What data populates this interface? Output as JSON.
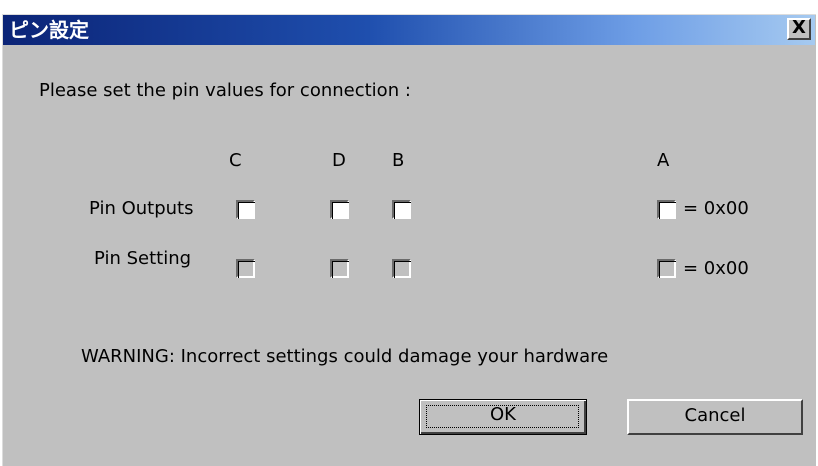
{
  "window": {
    "title": "ピン設定",
    "close_label": "X"
  },
  "dialog": {
    "instruction": "Please set the pin values for connection :",
    "columns": {
      "c": "C",
      "d": "D",
      "b": "B",
      "a": "A"
    },
    "rows": {
      "outputs_label": "Pin Outputs",
      "setting_label": "Pin Setting"
    },
    "outputs_value": "= 0x00",
    "setting_value": "= 0x00",
    "warning": "WARNING: Incorrect settings could damage your hardware",
    "ok_label": "OK",
    "cancel_label": "Cancel"
  },
  "checkboxes": {
    "outputs": {
      "c": false,
      "d": false,
      "b": false,
      "a": false
    },
    "setting": {
      "c": false,
      "d": false,
      "b": false,
      "a": false
    }
  },
  "colors": {
    "title_gradient_start": "#0b2477",
    "title_gradient_end": "#a6caf0",
    "dialog_background": "#c0c0c0"
  }
}
